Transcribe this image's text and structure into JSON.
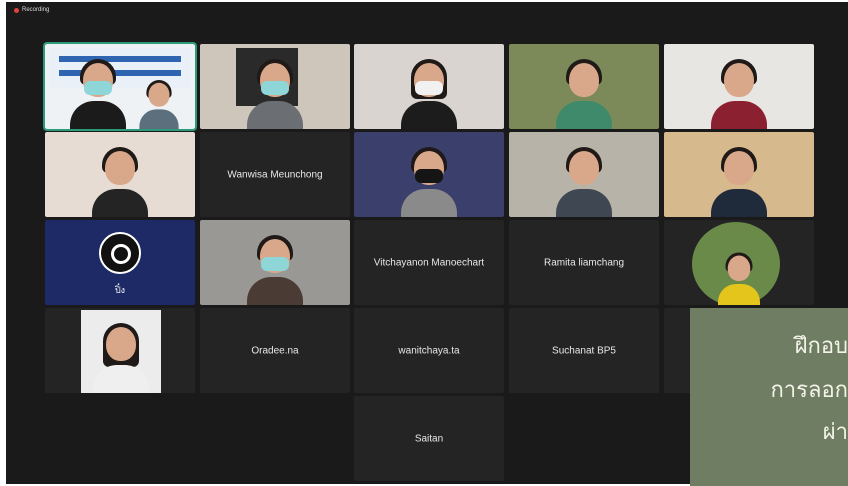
{
  "recording": {
    "label": "Recording"
  },
  "participants": {
    "wanwisa": "Wanwisa Meunchong",
    "vitchayanon": "Vitchayanon Manoechart",
    "ramita": "Ramita liamchang",
    "oradee": "Oradee.na",
    "wanitchaya": "wanitchaya.ta",
    "suchanat": "Suchanat BP5",
    "saitan": "Saitan",
    "obs_label": "ปิ๋ง"
  },
  "banner": {
    "line1": "ฝึกอบ",
    "line2": "การลอก",
    "line3": "ผ่า"
  }
}
